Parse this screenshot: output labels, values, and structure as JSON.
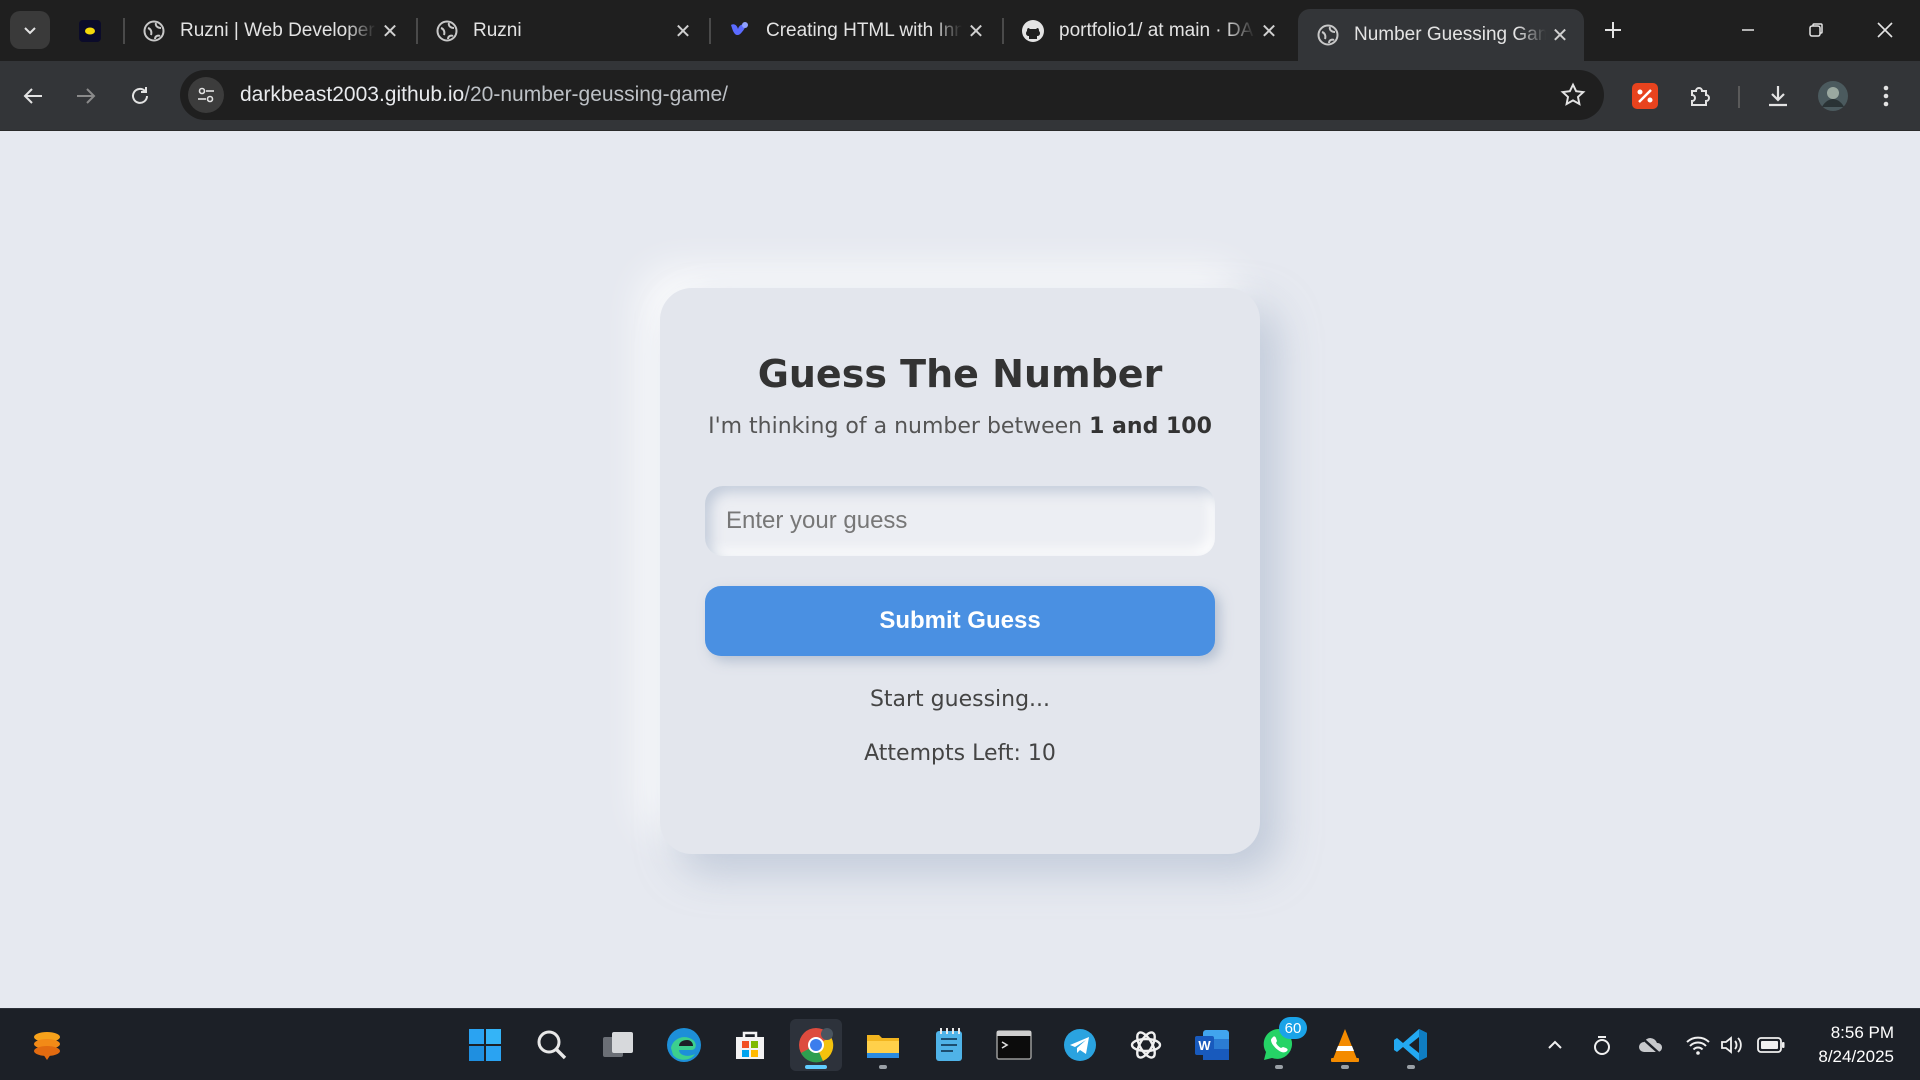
{
  "browser": {
    "tabs": [
      {
        "title": "",
        "favicon": "moon-icon"
      },
      {
        "title": "Ruzni | Web Developer",
        "favicon": "globe-icon"
      },
      {
        "title": "Ruzni",
        "favicon": "globe-icon"
      },
      {
        "title": "Creating HTML with Inn",
        "favicon": "copilot-icon"
      },
      {
        "title": "portfolio1/ at main · DA",
        "favicon": "github-icon"
      },
      {
        "title": "Number Guessing Gam",
        "favicon": "globe-icon"
      }
    ],
    "address": {
      "domain": "darkbeast2003.github.io",
      "path": "/20-number-geussing-game/"
    }
  },
  "game": {
    "title": "Guess The Number",
    "subtitle_prefix": "I'm thinking of a number between ",
    "subtitle_range": "1 and 100",
    "input_placeholder": "Enter your guess",
    "submit_label": "Submit Guess",
    "message": "Start guessing...",
    "attempts": "Attempts Left: 10"
  },
  "taskbar": {
    "whatsapp_badge": "60",
    "time": "8:56 PM",
    "date": "8/24/2025"
  },
  "colors": {
    "accent": "#4a90e2",
    "page_bg": "#e6e9f0",
    "card_bg": "#e3e6ed"
  }
}
